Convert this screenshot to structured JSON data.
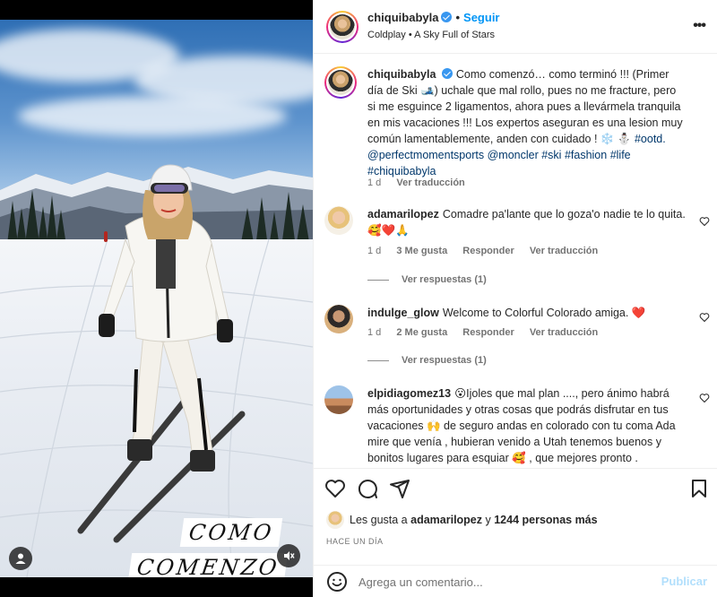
{
  "post": {
    "author": "chiquibabyla",
    "follow_label": "Seguir",
    "song": "Coldplay • A Sky Full of Stars",
    "media_caption_line1": "COMO",
    "media_caption_line2": "COMENZO"
  },
  "caption": {
    "username": "chiquibabyla",
    "text_part1": "Como comenzó… como terminó !!! (Primer día de Ski 🎿) uchale que mal rollo, pues no me fracture, pero si me esguince 2 ligamentos, ahora pues a llevármela tranquila en mis vacaciones !!! Los expertos aseguran es una lesion muy común lamentablemente, anden con cuidado ! ❄️ ⛄ ",
    "tag_ootd": "#ootd.",
    "tag_perfect": "@perfectmomentsports",
    "tag_moncler": "@moncler",
    "tag_ski": "#ski",
    "tag_fashion": "#fashion",
    "tag_life": "#life",
    "tag_chiqui": "#chiquibabyla",
    "time": "1 d",
    "translate": "Ver traducción"
  },
  "comments": [
    {
      "username": "adamarilopez",
      "text": "Comadre pa'lante que lo goza'o nadie te lo quita. 🥰❤️🙏",
      "time": "1 d",
      "likes": "3 Me gusta",
      "reply": "Responder",
      "translate": "Ver traducción",
      "replies": "Ver respuestas (1)"
    },
    {
      "username": "indulge_glow",
      "text": "Welcome to Colorful Colorado amiga. ❤️",
      "time": "1 d",
      "likes": "2 Me gusta",
      "reply": "Responder",
      "translate": "Ver traducción",
      "replies": "Ver respuestas (1)"
    },
    {
      "username": "elpidiagomez13",
      "text": "😮Ijoles que mal plan ...., pero ánimo habrá más oportunidades y otras cosas que podrás disfrutar en tus vacaciones 🙌 de seguro andas en colorado con tu coma Ada mire que venía , hubieran venido a Utah tenemos buenos y bonitos lugares para esquiar 🥰 , que mejores pronto ."
    }
  ],
  "likes": {
    "prefix": "Les gusta a",
    "user": "adamarilopez",
    "middle": "y",
    "count": "1244 personas más"
  },
  "date": "HACE UN DÍA",
  "add_comment": {
    "placeholder": "Agrega un comentario...",
    "post_label": "Publicar"
  },
  "colors": {
    "accent": "#0095f6",
    "verified": "#3897f0",
    "like_heart": "#ed4956"
  },
  "icons": [
    "verified-badge-icon",
    "more-options-icon",
    "heart-icon",
    "comment-icon",
    "share-icon",
    "save-icon",
    "emoji-icon",
    "user-tag-icon",
    "muted-icon"
  ]
}
